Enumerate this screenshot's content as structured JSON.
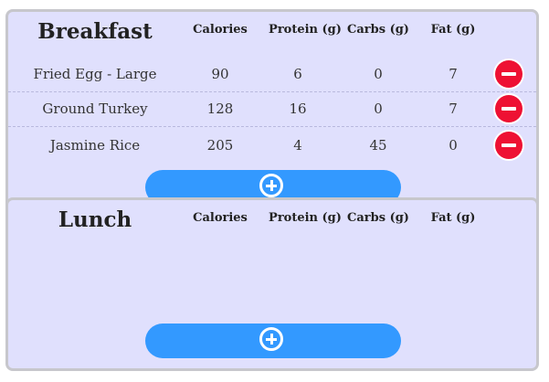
{
  "columns": {
    "calories": "Calories",
    "protein": "Protein (g)",
    "carbs": "Carbs (g)",
    "fat": "Fat (g)"
  },
  "breakfast": {
    "title": "Breakfast",
    "items": [
      {
        "name": "Fried Egg - Large",
        "calories": "90",
        "protein": "6",
        "carbs": "0",
        "fat": "7"
      },
      {
        "name": "Ground Turkey",
        "calories": "128",
        "protein": "16",
        "carbs": "0",
        "fat": "7"
      },
      {
        "name": "Jasmine Rice",
        "calories": "205",
        "protein": "4",
        "carbs": "45",
        "fat": "0"
      }
    ]
  },
  "lunch": {
    "title": "Lunch",
    "items": []
  },
  "icons": {
    "remove": "remove-circle-icon",
    "add": "add-circle-icon"
  },
  "colors": {
    "card_background": "#e0e0fd",
    "card_border": "#c7c7cc",
    "remove_button": "#ee1133",
    "add_button": "#3399ff"
  }
}
